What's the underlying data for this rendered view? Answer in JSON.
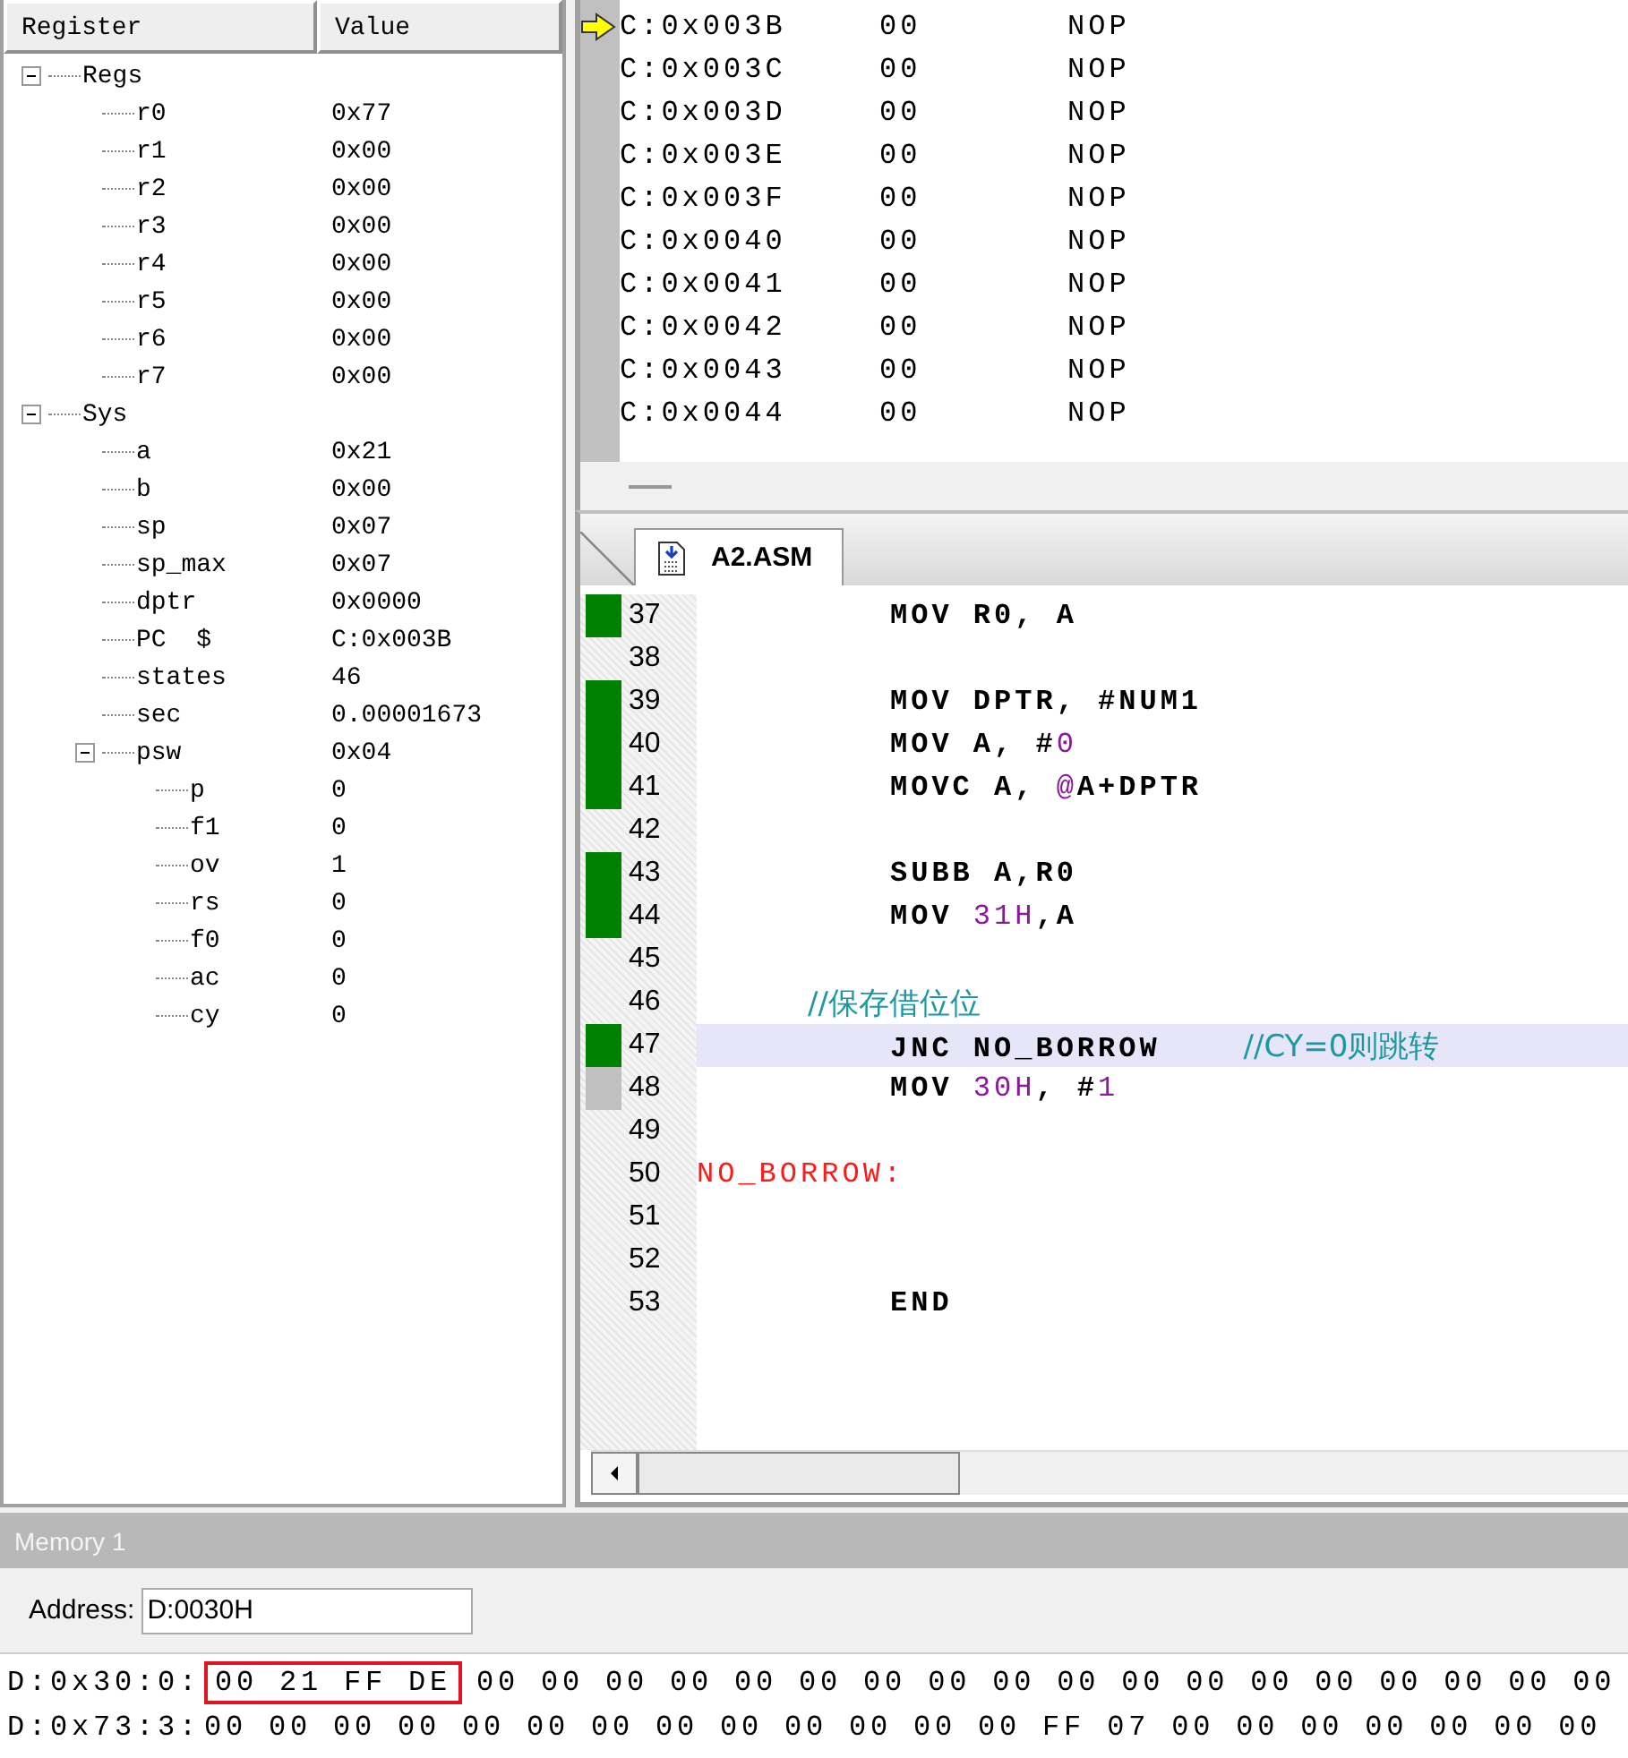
{
  "registers": {
    "columns": [
      "Register",
      "Value"
    ],
    "tree": [
      {
        "name": "Regs",
        "expanded": true,
        "children": [
          {
            "name": "r0",
            "value": "0x77"
          },
          {
            "name": "r1",
            "value": "0x00"
          },
          {
            "name": "r2",
            "value": "0x00"
          },
          {
            "name": "r3",
            "value": "0x00"
          },
          {
            "name": "r4",
            "value": "0x00"
          },
          {
            "name": "r5",
            "value": "0x00"
          },
          {
            "name": "r6",
            "value": "0x00"
          },
          {
            "name": "r7",
            "value": "0x00"
          }
        ]
      },
      {
        "name": "Sys",
        "expanded": true,
        "children": [
          {
            "name": "a",
            "value": "0x21"
          },
          {
            "name": "b",
            "value": "0x00"
          },
          {
            "name": "sp",
            "value": "0x07"
          },
          {
            "name": "sp_max",
            "value": "0x07"
          },
          {
            "name": "dptr",
            "value": "0x0000"
          },
          {
            "name": "PC  $",
            "value": "C:0x003B"
          },
          {
            "name": "states",
            "value": "46"
          },
          {
            "name": "sec",
            "value": "0.00001673"
          },
          {
            "name": "psw",
            "value": "0x04",
            "expanded": true,
            "children": [
              {
                "name": "p",
                "value": "0"
              },
              {
                "name": "f1",
                "value": "0"
              },
              {
                "name": "ov",
                "value": "1"
              },
              {
                "name": "rs",
                "value": "0"
              },
              {
                "name": "f0",
                "value": "0"
              },
              {
                "name": "ac",
                "value": "0"
              },
              {
                "name": "cy",
                "value": "0"
              }
            ]
          }
        ]
      }
    ]
  },
  "disassembly": [
    {
      "address": "C:0x003B",
      "bytes": "00",
      "instruction": "NOP",
      "current": true
    },
    {
      "address": "C:0x003C",
      "bytes": "00",
      "instruction": "NOP",
      "current": false
    },
    {
      "address": "C:0x003D",
      "bytes": "00",
      "instruction": "NOP",
      "current": false
    },
    {
      "address": "C:0x003E",
      "bytes": "00",
      "instruction": "NOP",
      "current": false
    },
    {
      "address": "C:0x003F",
      "bytes": "00",
      "instruction": "NOP",
      "current": false
    },
    {
      "address": "C:0x0040",
      "bytes": "00",
      "instruction": "NOP",
      "current": false
    },
    {
      "address": "C:0x0041",
      "bytes": "00",
      "instruction": "NOP",
      "current": false
    },
    {
      "address": "C:0x0042",
      "bytes": "00",
      "instruction": "NOP",
      "current": false
    },
    {
      "address": "C:0x0043",
      "bytes": "00",
      "instruction": "NOP",
      "current": false
    },
    {
      "address": "C:0x0044",
      "bytes": "00",
      "instruction": "NOP",
      "current": false
    }
  ],
  "editor": {
    "tabs": [
      {
        "label": "A2.ASM",
        "selected": true
      }
    ],
    "lines": [
      {
        "number": "37",
        "color": "#008000",
        "highlighted": false,
        "kind": "instruction",
        "tokens": [
          {
            "text": "MOV R0, A",
            "kind": "code"
          }
        ]
      },
      {
        "number": "38",
        "highlighted": false
      },
      {
        "number": "39",
        "color": "#008000",
        "highlighted": false,
        "kind": "instruction",
        "tokens": [
          {
            "text": "MOV DPTR, #NUM1",
            "kind": "code"
          }
        ]
      },
      {
        "number": "40",
        "color": "#008000",
        "highlighted": false,
        "kind": "instruction",
        "tokens": [
          {
            "text": "MOV A, #",
            "kind": "code"
          },
          {
            "text": "0",
            "kind": "number"
          }
        ]
      },
      {
        "number": "41",
        "color": "#008000",
        "highlighted": false,
        "kind": "instruction",
        "tokens": [
          {
            "text": "MOVC A, ",
            "kind": "code"
          },
          {
            "text": "@",
            "kind": "number"
          },
          {
            "text": "A+DPTR",
            "kind": "code"
          }
        ]
      },
      {
        "number": "42",
        "highlighted": false
      },
      {
        "number": "43",
        "color": "#008000",
        "highlighted": false,
        "kind": "instruction",
        "tokens": [
          {
            "text": "SUBB A,R0",
            "kind": "code"
          }
        ]
      },
      {
        "number": "44",
        "color": "#008000",
        "highlighted": false,
        "kind": "instruction",
        "tokens": [
          {
            "text": "MOV ",
            "kind": "code"
          },
          {
            "text": "31H",
            "kind": "number"
          },
          {
            "text": ",A",
            "kind": "code"
          }
        ]
      },
      {
        "number": "45",
        "highlighted": false
      },
      {
        "number": "46",
        "highlighted": false,
        "kind": "comment",
        "tokens": [
          {
            "text": "//保存借位位",
            "kind": "comment"
          }
        ]
      },
      {
        "number": "47",
        "color": "#008000",
        "highlighted": true,
        "kind": "instruction",
        "tokens": [
          {
            "text": "JNC NO_BORROW    ",
            "kind": "code"
          },
          {
            "text": "//CY=0则跳转",
            "kind": "comment"
          }
        ]
      },
      {
        "number": "48",
        "color": "#c0c0c0",
        "highlighted": false,
        "kind": "instruction",
        "tokens": [
          {
            "text": "MOV ",
            "kind": "code"
          },
          {
            "text": "30H",
            "kind": "number"
          },
          {
            "text": ", #",
            "kind": "code"
          },
          {
            "text": "1",
            "kind": "number"
          }
        ]
      },
      {
        "number": "49",
        "highlighted": false
      },
      {
        "number": "50",
        "highlighted": false,
        "kind": "label",
        "tokens": [
          {
            "text": "NO_BORROW:",
            "kind": "label"
          }
        ]
      },
      {
        "number": "51",
        "highlighted": false
      },
      {
        "number": "52",
        "highlighted": false
      },
      {
        "number": "53",
        "highlighted": false,
        "kind": "instruction",
        "tokens": [
          {
            "text": "END",
            "kind": "code"
          }
        ]
      }
    ]
  },
  "memory": {
    "title": "Memory 1",
    "address_label": "Address:",
    "address_value": "D:0030H",
    "rows": [
      {
        "address": "D:0x30:0:",
        "highlighted_bytes": [
          "00",
          "21",
          "FF",
          "DE"
        ],
        "bytes": [
          "00",
          "00",
          "00",
          "00",
          "00",
          "00",
          "00",
          "00",
          "00",
          "00",
          "00",
          "00",
          "00",
          "00",
          "00",
          "00",
          "00",
          "00"
        ]
      },
      {
        "address": "D:0x73:3:",
        "bytes": [
          "00",
          "00",
          "00",
          "00",
          "00",
          "00",
          "00",
          "00",
          "00",
          "00",
          "00",
          "00",
          "00",
          "FF",
          "07",
          "00",
          "00",
          "00",
          "00",
          "00",
          "00",
          "00"
        ]
      }
    ]
  }
}
